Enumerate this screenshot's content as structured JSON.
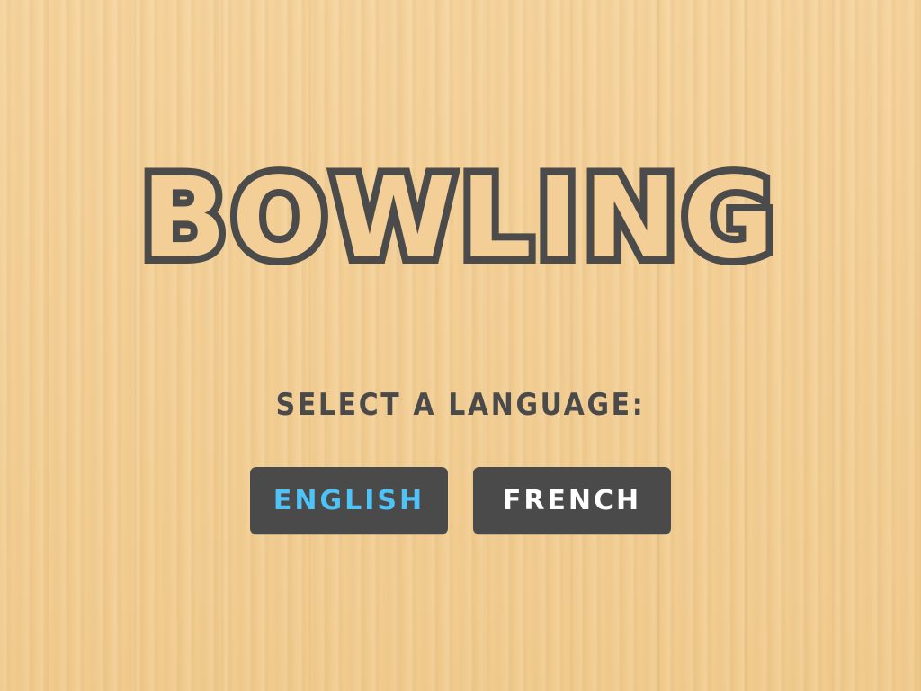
{
  "game": {
    "title": "BOWLING",
    "prompt": "SELECT A LANGUAGE:"
  },
  "languages": [
    {
      "label": "ENGLISH",
      "selected": true,
      "color": "#4fc3f7"
    },
    {
      "label": "FRENCH",
      "selected": false,
      "color": "#ffffff"
    }
  ],
  "colors": {
    "background": "#f3cf97",
    "dark": "#4a4a4a",
    "accent": "#4fc3f7"
  }
}
